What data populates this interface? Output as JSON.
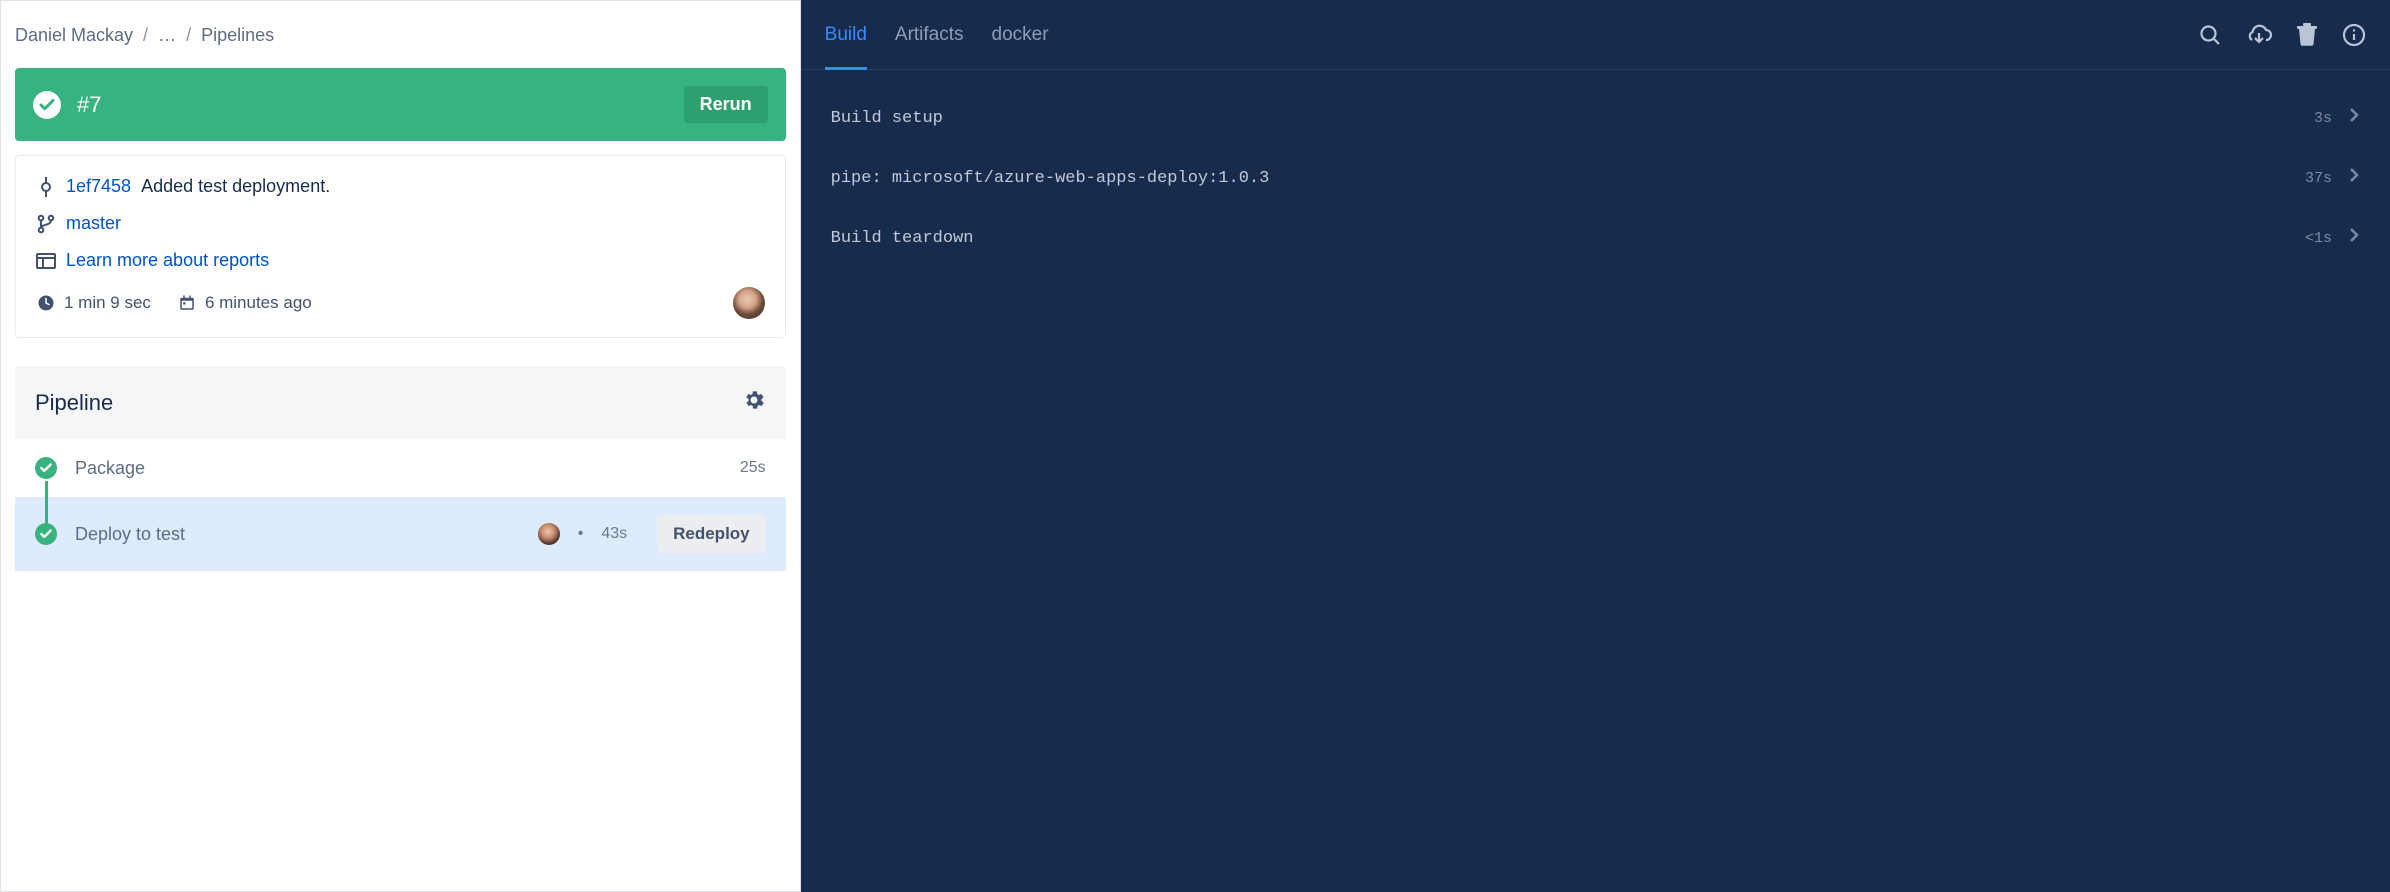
{
  "breadcrumb": {
    "owner": "Daniel Mackay",
    "ellipsis": "…",
    "current": "Pipelines"
  },
  "run": {
    "status": "success",
    "number": "#7",
    "rerun_label": "Rerun"
  },
  "commit": {
    "hash": "1ef7458",
    "message": "Added test deployment.",
    "branch": "master",
    "reports_link": "Learn more about reports",
    "duration": "1 min 9 sec",
    "relative_time": "6 minutes ago"
  },
  "pipeline_section": {
    "title": "Pipeline",
    "stages": [
      {
        "label": "Package",
        "time": "25s",
        "status": "success"
      },
      {
        "label": "Deploy to test",
        "time": "43s",
        "status": "success",
        "redeploy_label": "Redeploy"
      }
    ]
  },
  "tabs": {
    "items": [
      "Build",
      "Artifacts",
      "docker"
    ],
    "active_index": 0
  },
  "log": {
    "rows": [
      {
        "text": "Build setup",
        "time": "3s"
      },
      {
        "text": "pipe: microsoft/azure-web-apps-deploy:1.0.3",
        "time": "37s"
      },
      {
        "text": "Build teardown",
        "time": "<1s"
      }
    ]
  }
}
